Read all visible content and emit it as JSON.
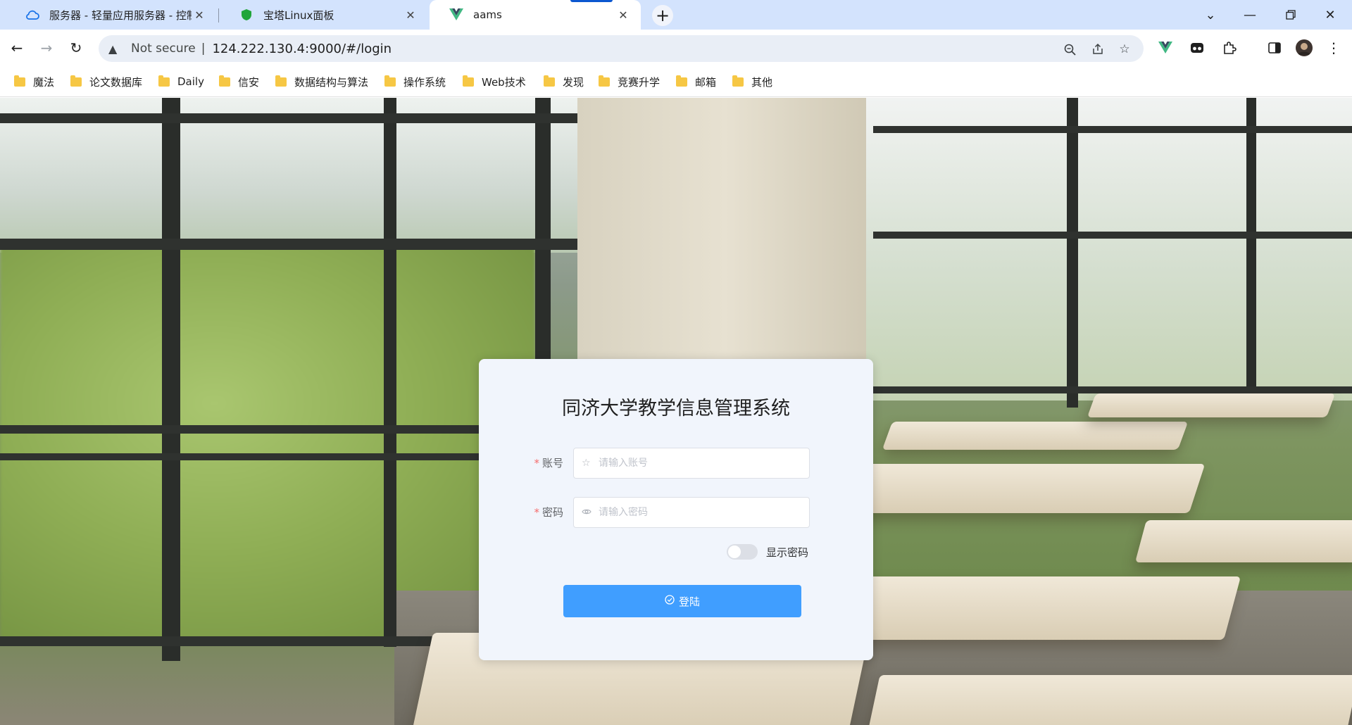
{
  "browser": {
    "tabs": [
      {
        "title": "服务器 - 轻量应用服务器 - 控制",
        "icon": "cloud-icon"
      },
      {
        "title": "宝塔Linux面板",
        "icon": "shield-icon"
      },
      {
        "title": "aams",
        "icon": "vue-logo-icon",
        "active": true
      }
    ],
    "new_tab_label": "+",
    "address": {
      "security_label": "Not secure",
      "separator": "|",
      "url": "124.222.130.4:9000/#/login"
    },
    "bookmarks": [
      "魔法",
      "论文数据库",
      "Daily",
      "信安",
      "数据结构与算法",
      "操作系统",
      "Web技术",
      "发现",
      "竞赛升学",
      "邮箱",
      "其他"
    ]
  },
  "login": {
    "title": "同济大学教学信息管理系统",
    "required_mark": "*",
    "account_label": "账号",
    "account_placeholder": "请输入账号",
    "password_label": "密码",
    "password_placeholder": "请输入密码",
    "show_password_label": "显示密码",
    "show_password_on": false,
    "submit_label": "登陆"
  },
  "colors": {
    "primary": "#409eff",
    "required": "#f56c6c",
    "card_bg": "#f1f5fc"
  }
}
